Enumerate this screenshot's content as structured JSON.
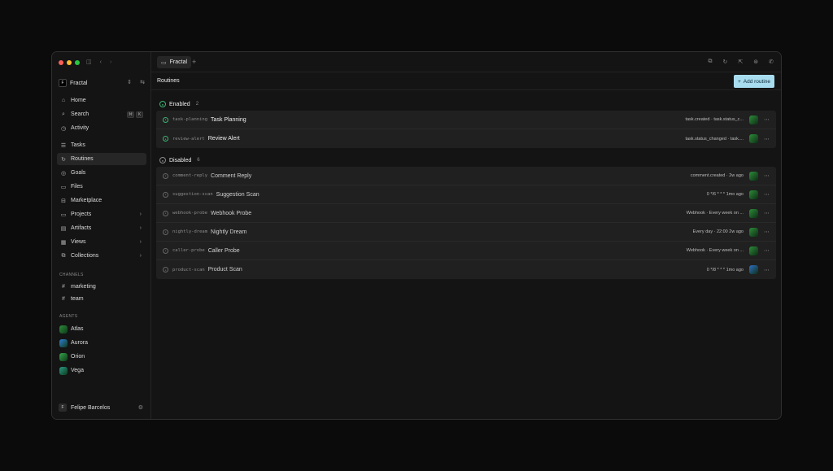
{
  "workspace": {
    "name": "Fractal",
    "logo": "F"
  },
  "nav": [
    {
      "label": "Home",
      "icon": "home-icon",
      "glyph": "⌂"
    },
    {
      "label": "Search",
      "icon": "search-icon",
      "glyph": "⌕",
      "kbd": [
        "⌘",
        "K"
      ]
    },
    {
      "label": "Activity",
      "icon": "activity-icon",
      "glyph": "◷"
    },
    {
      "label": "Tasks",
      "icon": "tasks-icon",
      "glyph": "☰"
    },
    {
      "label": "Routines",
      "icon": "routines-icon",
      "glyph": "↻",
      "active": true
    },
    {
      "label": "Goals",
      "icon": "goals-icon",
      "glyph": "◎"
    },
    {
      "label": "Files",
      "icon": "files-icon",
      "glyph": "▭"
    },
    {
      "label": "Marketplace",
      "icon": "marketplace-icon",
      "glyph": "⊟"
    },
    {
      "label": "Projects",
      "icon": "folder-icon",
      "glyph": "▭",
      "chevron": true
    },
    {
      "label": "Artifacts",
      "icon": "artifacts-icon",
      "glyph": "▤",
      "chevron": true
    },
    {
      "label": "Views",
      "icon": "views-icon",
      "glyph": "▦",
      "chevron": true
    },
    {
      "label": "Collections",
      "icon": "collections-icon",
      "glyph": "⧉",
      "chevron": true
    }
  ],
  "channels": {
    "title": "CHANNELS",
    "items": [
      "marketing",
      "team"
    ]
  },
  "agents": {
    "title": "AGENTS",
    "items": [
      {
        "name": "Atlas",
        "color": "#2e8b3a"
      },
      {
        "name": "Aurora",
        "color": "#2f7fd4"
      },
      {
        "name": "Orion",
        "color": "#37a34a"
      },
      {
        "name": "Vega",
        "color": "#2a9a86"
      }
    ]
  },
  "user": {
    "name": "Felipe Barcelos",
    "initial": "F"
  },
  "tab": {
    "label": "Fractal"
  },
  "page": {
    "title": "Routines",
    "add_label": "Add routine"
  },
  "enabled": {
    "label": "Enabled",
    "count": "2",
    "rows": [
      {
        "slug": "task-planning",
        "name": "Task Planning",
        "meta": "task.created · task.status_c...",
        "avatar": "#2e8b3a"
      },
      {
        "slug": "review-alert",
        "name": "Review Alert",
        "meta": "task.status_changed · task....",
        "avatar": "#2e8b3a"
      }
    ]
  },
  "disabled": {
    "label": "Disabled",
    "count": "6",
    "rows": [
      {
        "slug": "comment-reply",
        "name": "Comment Reply",
        "meta": "comment.created · 2w ago",
        "avatar": "#2e8b3a"
      },
      {
        "slug": "suggestion-scan",
        "name": "Suggestion Scan",
        "meta": "0 */6 * * *   1mo ago",
        "avatar": "#2e8b3a"
      },
      {
        "slug": "webhook-probe",
        "name": "Webhook Probe",
        "meta": "Webhook · Every week on ...",
        "avatar": "#2e8b3a"
      },
      {
        "slug": "nightly-dream",
        "name": "Nightly Dream",
        "meta": "Every day · 22:00   2w ago",
        "avatar": "#2e8b3a"
      },
      {
        "slug": "caller-probe",
        "name": "Caller Probe",
        "meta": "Webhook · Every week on ...",
        "avatar": "#2e8b3a"
      },
      {
        "slug": "product-scan",
        "name": "Product Scan",
        "meta": "0 */8 * * *   1mo ago",
        "avatar": "#2f6fc4"
      }
    ]
  }
}
